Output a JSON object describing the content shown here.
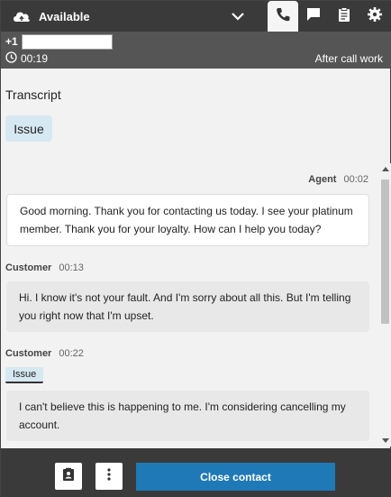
{
  "status": {
    "label": "Available"
  },
  "contact": {
    "phone_prefix": "+1",
    "phone_number": "",
    "timer": "00:19",
    "state": "After call work"
  },
  "transcript": {
    "title": "Transcript",
    "category_chip": "Issue",
    "messages": [
      {
        "speaker": "Agent",
        "time": "00:02",
        "text": "Good morning. Thank you for contacting us today. I see your platinum member. Thank you for your loyalty. How can I help you today?"
      },
      {
        "speaker": "Customer",
        "time": "00:13",
        "text": "Hi. I know it's not your fault. And I'm sorry about all this. But I'm telling you right now that I'm upset."
      },
      {
        "speaker": "Customer",
        "time": "00:22",
        "tag": "Issue",
        "text": "I can't believe this is happening to me. I'm considering cancelling my account."
      }
    ]
  },
  "actions": {
    "close_contact": "Close contact"
  },
  "icons": {
    "status": "cloud-icon",
    "status_caret": "chevron-down-icon",
    "tabs": [
      "phone-icon",
      "chat-icon",
      "clipboard-icon",
      "gear-icon"
    ],
    "timer": "clock-icon",
    "bottom": [
      "contact-card-icon",
      "more-vertical-icon"
    ]
  },
  "colors": {
    "topbar": "#3a3a3a",
    "contact_bar": "#555555",
    "accent": "#1f79b6",
    "issue_highlight": "#d6e8f2"
  }
}
